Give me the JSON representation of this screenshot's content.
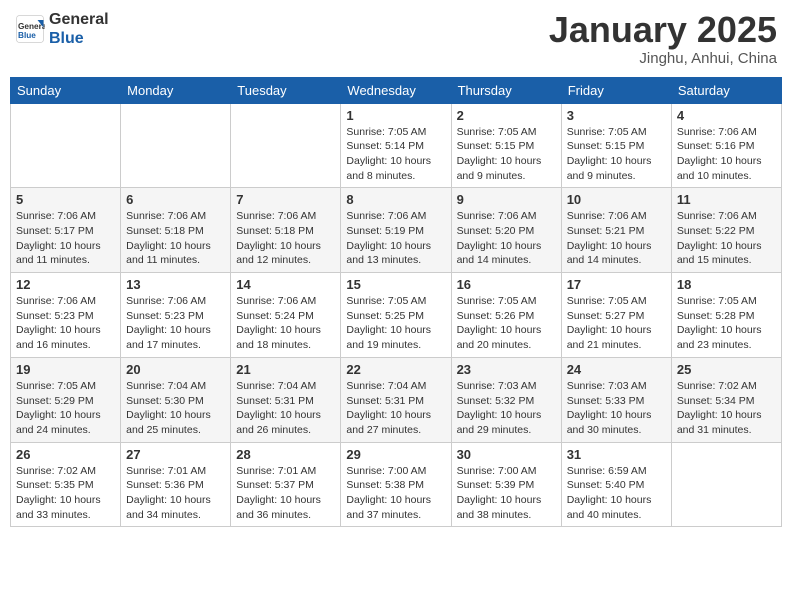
{
  "header": {
    "logo_line1": "General",
    "logo_line2": "Blue",
    "month_title": "January 2025",
    "location": "Jinghu, Anhui, China"
  },
  "weekdays": [
    "Sunday",
    "Monday",
    "Tuesday",
    "Wednesday",
    "Thursday",
    "Friday",
    "Saturday"
  ],
  "weeks": [
    [
      {
        "day": "",
        "detail": ""
      },
      {
        "day": "",
        "detail": ""
      },
      {
        "day": "",
        "detail": ""
      },
      {
        "day": "1",
        "detail": "Sunrise: 7:05 AM\nSunset: 5:14 PM\nDaylight: 10 hours\nand 8 minutes."
      },
      {
        "day": "2",
        "detail": "Sunrise: 7:05 AM\nSunset: 5:15 PM\nDaylight: 10 hours\nand 9 minutes."
      },
      {
        "day": "3",
        "detail": "Sunrise: 7:05 AM\nSunset: 5:15 PM\nDaylight: 10 hours\nand 9 minutes."
      },
      {
        "day": "4",
        "detail": "Sunrise: 7:06 AM\nSunset: 5:16 PM\nDaylight: 10 hours\nand 10 minutes."
      }
    ],
    [
      {
        "day": "5",
        "detail": "Sunrise: 7:06 AM\nSunset: 5:17 PM\nDaylight: 10 hours\nand 11 minutes."
      },
      {
        "day": "6",
        "detail": "Sunrise: 7:06 AM\nSunset: 5:18 PM\nDaylight: 10 hours\nand 11 minutes."
      },
      {
        "day": "7",
        "detail": "Sunrise: 7:06 AM\nSunset: 5:18 PM\nDaylight: 10 hours\nand 12 minutes."
      },
      {
        "day": "8",
        "detail": "Sunrise: 7:06 AM\nSunset: 5:19 PM\nDaylight: 10 hours\nand 13 minutes."
      },
      {
        "day": "9",
        "detail": "Sunrise: 7:06 AM\nSunset: 5:20 PM\nDaylight: 10 hours\nand 14 minutes."
      },
      {
        "day": "10",
        "detail": "Sunrise: 7:06 AM\nSunset: 5:21 PM\nDaylight: 10 hours\nand 14 minutes."
      },
      {
        "day": "11",
        "detail": "Sunrise: 7:06 AM\nSunset: 5:22 PM\nDaylight: 10 hours\nand 15 minutes."
      }
    ],
    [
      {
        "day": "12",
        "detail": "Sunrise: 7:06 AM\nSunset: 5:23 PM\nDaylight: 10 hours\nand 16 minutes."
      },
      {
        "day": "13",
        "detail": "Sunrise: 7:06 AM\nSunset: 5:23 PM\nDaylight: 10 hours\nand 17 minutes."
      },
      {
        "day": "14",
        "detail": "Sunrise: 7:06 AM\nSunset: 5:24 PM\nDaylight: 10 hours\nand 18 minutes."
      },
      {
        "day": "15",
        "detail": "Sunrise: 7:05 AM\nSunset: 5:25 PM\nDaylight: 10 hours\nand 19 minutes."
      },
      {
        "day": "16",
        "detail": "Sunrise: 7:05 AM\nSunset: 5:26 PM\nDaylight: 10 hours\nand 20 minutes."
      },
      {
        "day": "17",
        "detail": "Sunrise: 7:05 AM\nSunset: 5:27 PM\nDaylight: 10 hours\nand 21 minutes."
      },
      {
        "day": "18",
        "detail": "Sunrise: 7:05 AM\nSunset: 5:28 PM\nDaylight: 10 hours\nand 23 minutes."
      }
    ],
    [
      {
        "day": "19",
        "detail": "Sunrise: 7:05 AM\nSunset: 5:29 PM\nDaylight: 10 hours\nand 24 minutes."
      },
      {
        "day": "20",
        "detail": "Sunrise: 7:04 AM\nSunset: 5:30 PM\nDaylight: 10 hours\nand 25 minutes."
      },
      {
        "day": "21",
        "detail": "Sunrise: 7:04 AM\nSunset: 5:31 PM\nDaylight: 10 hours\nand 26 minutes."
      },
      {
        "day": "22",
        "detail": "Sunrise: 7:04 AM\nSunset: 5:31 PM\nDaylight: 10 hours\nand 27 minutes."
      },
      {
        "day": "23",
        "detail": "Sunrise: 7:03 AM\nSunset: 5:32 PM\nDaylight: 10 hours\nand 29 minutes."
      },
      {
        "day": "24",
        "detail": "Sunrise: 7:03 AM\nSunset: 5:33 PM\nDaylight: 10 hours\nand 30 minutes."
      },
      {
        "day": "25",
        "detail": "Sunrise: 7:02 AM\nSunset: 5:34 PM\nDaylight: 10 hours\nand 31 minutes."
      }
    ],
    [
      {
        "day": "26",
        "detail": "Sunrise: 7:02 AM\nSunset: 5:35 PM\nDaylight: 10 hours\nand 33 minutes."
      },
      {
        "day": "27",
        "detail": "Sunrise: 7:01 AM\nSunset: 5:36 PM\nDaylight: 10 hours\nand 34 minutes."
      },
      {
        "day": "28",
        "detail": "Sunrise: 7:01 AM\nSunset: 5:37 PM\nDaylight: 10 hours\nand 36 minutes."
      },
      {
        "day": "29",
        "detail": "Sunrise: 7:00 AM\nSunset: 5:38 PM\nDaylight: 10 hours\nand 37 minutes."
      },
      {
        "day": "30",
        "detail": "Sunrise: 7:00 AM\nSunset: 5:39 PM\nDaylight: 10 hours\nand 38 minutes."
      },
      {
        "day": "31",
        "detail": "Sunrise: 6:59 AM\nSunset: 5:40 PM\nDaylight: 10 hours\nand 40 minutes."
      },
      {
        "day": "",
        "detail": ""
      }
    ]
  ]
}
